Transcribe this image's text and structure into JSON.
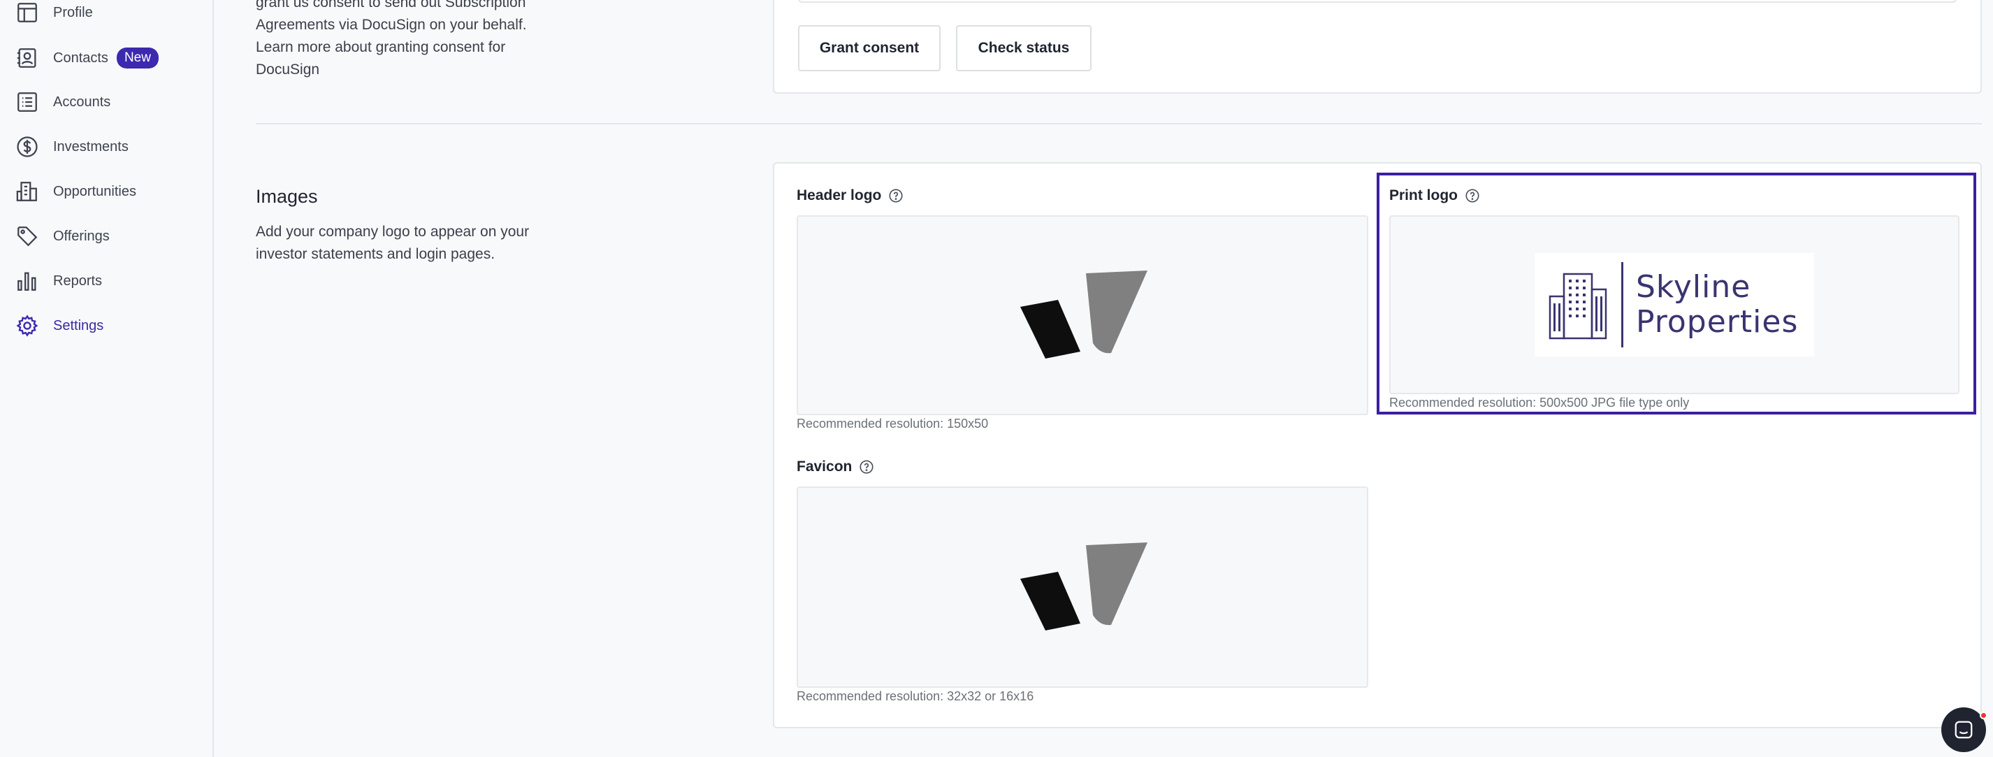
{
  "sidebar": {
    "items": [
      {
        "label": "Profile",
        "icon": "layout-icon"
      },
      {
        "label": "Contacts",
        "icon": "contact-card-icon",
        "badge": "New"
      },
      {
        "label": "Accounts",
        "icon": "list-icon"
      },
      {
        "label": "Investments",
        "icon": "dollar-circle-icon"
      },
      {
        "label": "Opportunities",
        "icon": "building-icon"
      },
      {
        "label": "Offerings",
        "icon": "tag-icon"
      },
      {
        "label": "Reports",
        "icon": "bar-chart-icon"
      },
      {
        "label": "Settings",
        "icon": "gear-icon",
        "active": true
      }
    ]
  },
  "docusign": {
    "description_lines": [
      "grant us consent to send out Subscription",
      "Agreements via DocuSign on your behalf.",
      "Learn more about granting consent for",
      "DocuSign"
    ],
    "grant_label": "Grant consent",
    "check_label": "Check status"
  },
  "images": {
    "title": "Images",
    "description": "Add your company logo to appear on your investor statements and login pages.",
    "header_logo": {
      "label": "Header logo",
      "hint": "Recommended resolution: 150x50"
    },
    "print_logo": {
      "label": "Print logo",
      "hint": "Recommended resolution: 500x500 JPG file type only",
      "logo_line1": "Skyline",
      "logo_line2": "Properties"
    },
    "favicon": {
      "label": "Favicon",
      "hint": "Recommended resolution: 32x32 or 16x16"
    }
  },
  "colors": {
    "accent": "#3b2ab0",
    "highlight": "#3b1fa3",
    "print_logo_text": "#3a3470"
  }
}
